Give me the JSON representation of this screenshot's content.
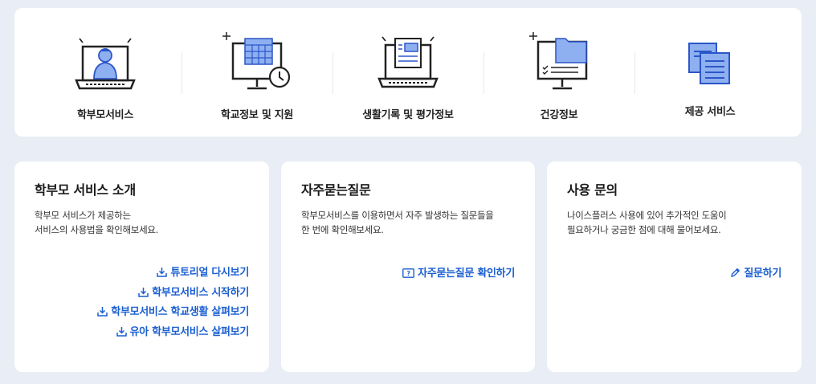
{
  "services": [
    {
      "label": "학부모서비스",
      "icon": "parent-monitor-icon"
    },
    {
      "label": "학교정보 및 지원",
      "icon": "calendar-clock-monitor-icon"
    },
    {
      "label": "생활기록 및 평가정보",
      "icon": "document-monitor-icon"
    },
    {
      "label": "건강정보",
      "icon": "folder-checklist-monitor-icon"
    },
    {
      "label": "제공 서비스",
      "icon": "documents-icon"
    }
  ],
  "intro": {
    "title": "학부모 서비스 소개",
    "desc_line1": "학부모 서비스가 제공하는",
    "desc_line2": "서비스의 사용법을 확인해보세요.",
    "links": [
      "튜토리얼 다시보기",
      "학부모서비스 시작하기",
      "학부모서비스 학교생활 살펴보기",
      "유아 학부모서비스 살펴보기"
    ]
  },
  "faq": {
    "title": "자주묻는질문",
    "desc_line1": "학부모서비스를 이용하면서 자주 발생하는 질문들을",
    "desc_line2": "한 번에 확인해보세요.",
    "link": "자주묻는질문 확인하기"
  },
  "inquiry": {
    "title": "사용 문의",
    "desc_line1": "나이스플러스 사용에 있어 추가적인 도움이",
    "desc_line2": "필요하거나 궁금한 점에 대해 물어보세요.",
    "link": "질문하기"
  },
  "colors": {
    "accent": "#1b5fd1",
    "icon_fill": "#8fb0f0",
    "background": "#e9edf5"
  }
}
